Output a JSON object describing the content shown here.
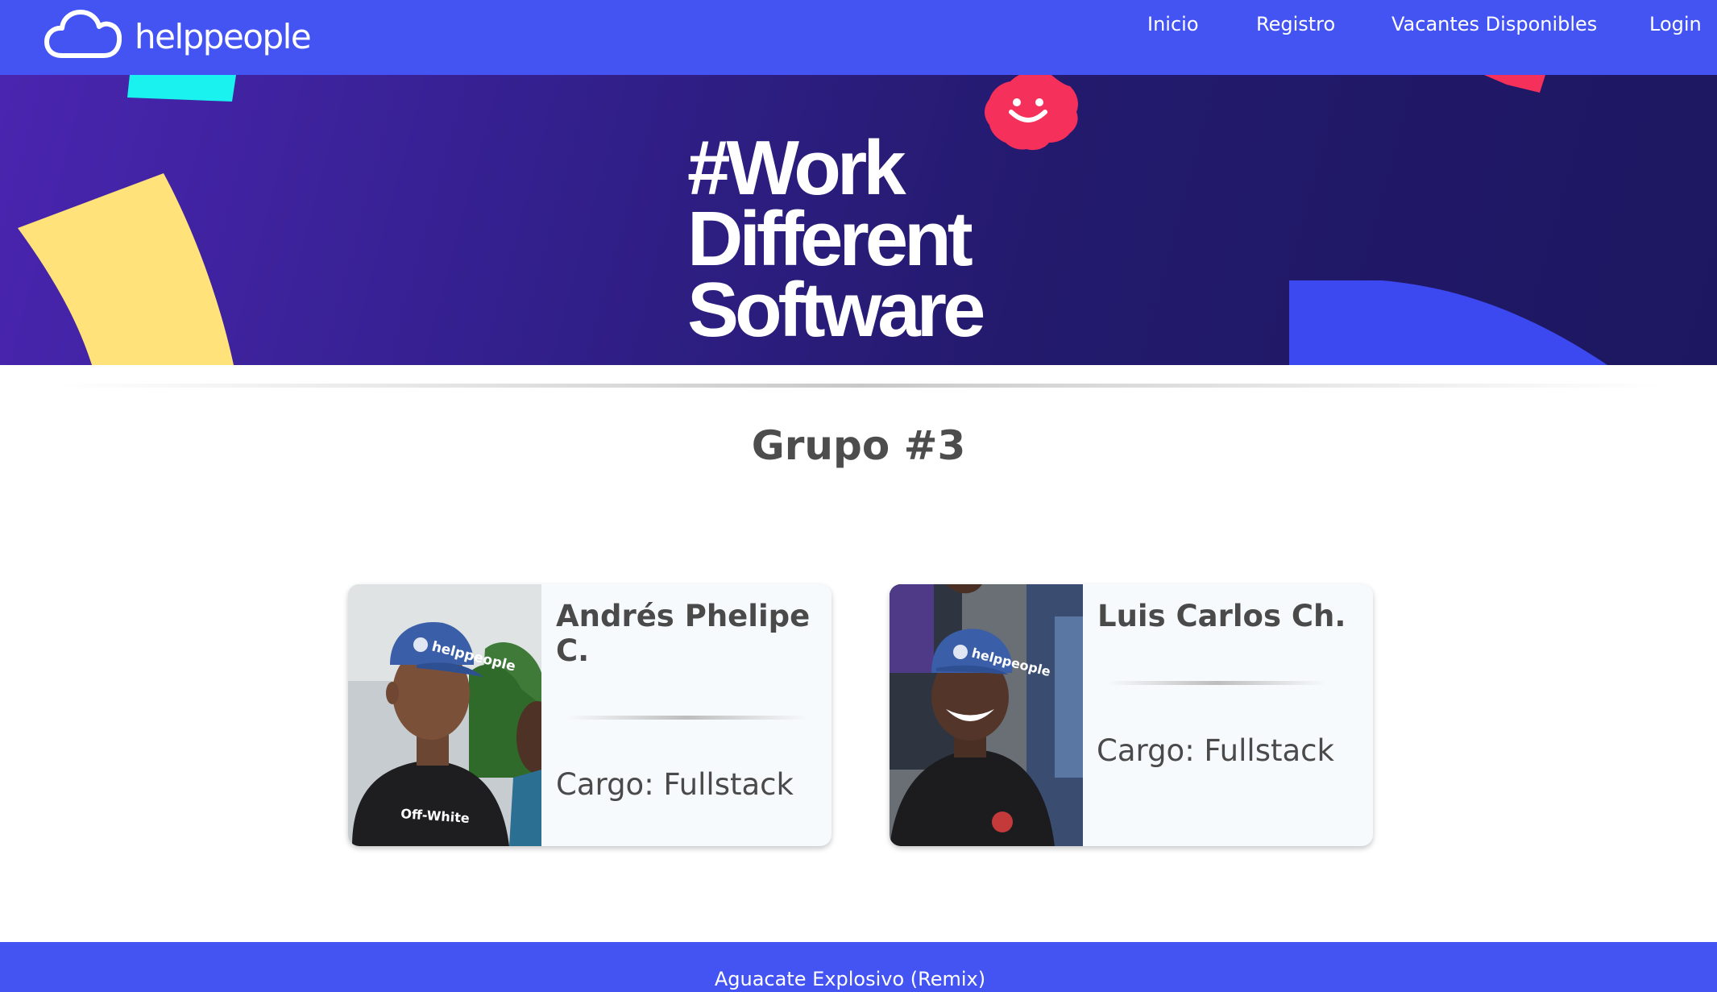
{
  "navbar": {
    "brand_name": "helppeople",
    "logo_icon": "cloud-icon",
    "links": [
      "Inicio",
      "Registro",
      "Vacantes Disponibles",
      "Login"
    ]
  },
  "hero": {
    "title_lines": [
      "#Work",
      "Different",
      "Software"
    ],
    "badge_icon": "smiley-badge-icon"
  },
  "group": {
    "title": "Grupo #3"
  },
  "members": [
    {
      "name": "Andrés Phelipe C.",
      "role": "Cargo: Fullstack",
      "cap_text": "helppeople",
      "shirt_text": "Off-White"
    },
    {
      "name": "Luis Carlos Ch.",
      "role": "Cargo: Fullstack",
      "cap_text": "helppeople"
    }
  ],
  "footer": {
    "text": "Aguacate Explosivo (Remix)"
  },
  "colors": {
    "primary": "#4454f3",
    "hero_dark": "#1d1761",
    "accent_pink": "#f5305b",
    "accent_yellow": "#ffe27a",
    "accent_cyan": "#19f2ee",
    "text_dark": "#4a4a4a"
  }
}
